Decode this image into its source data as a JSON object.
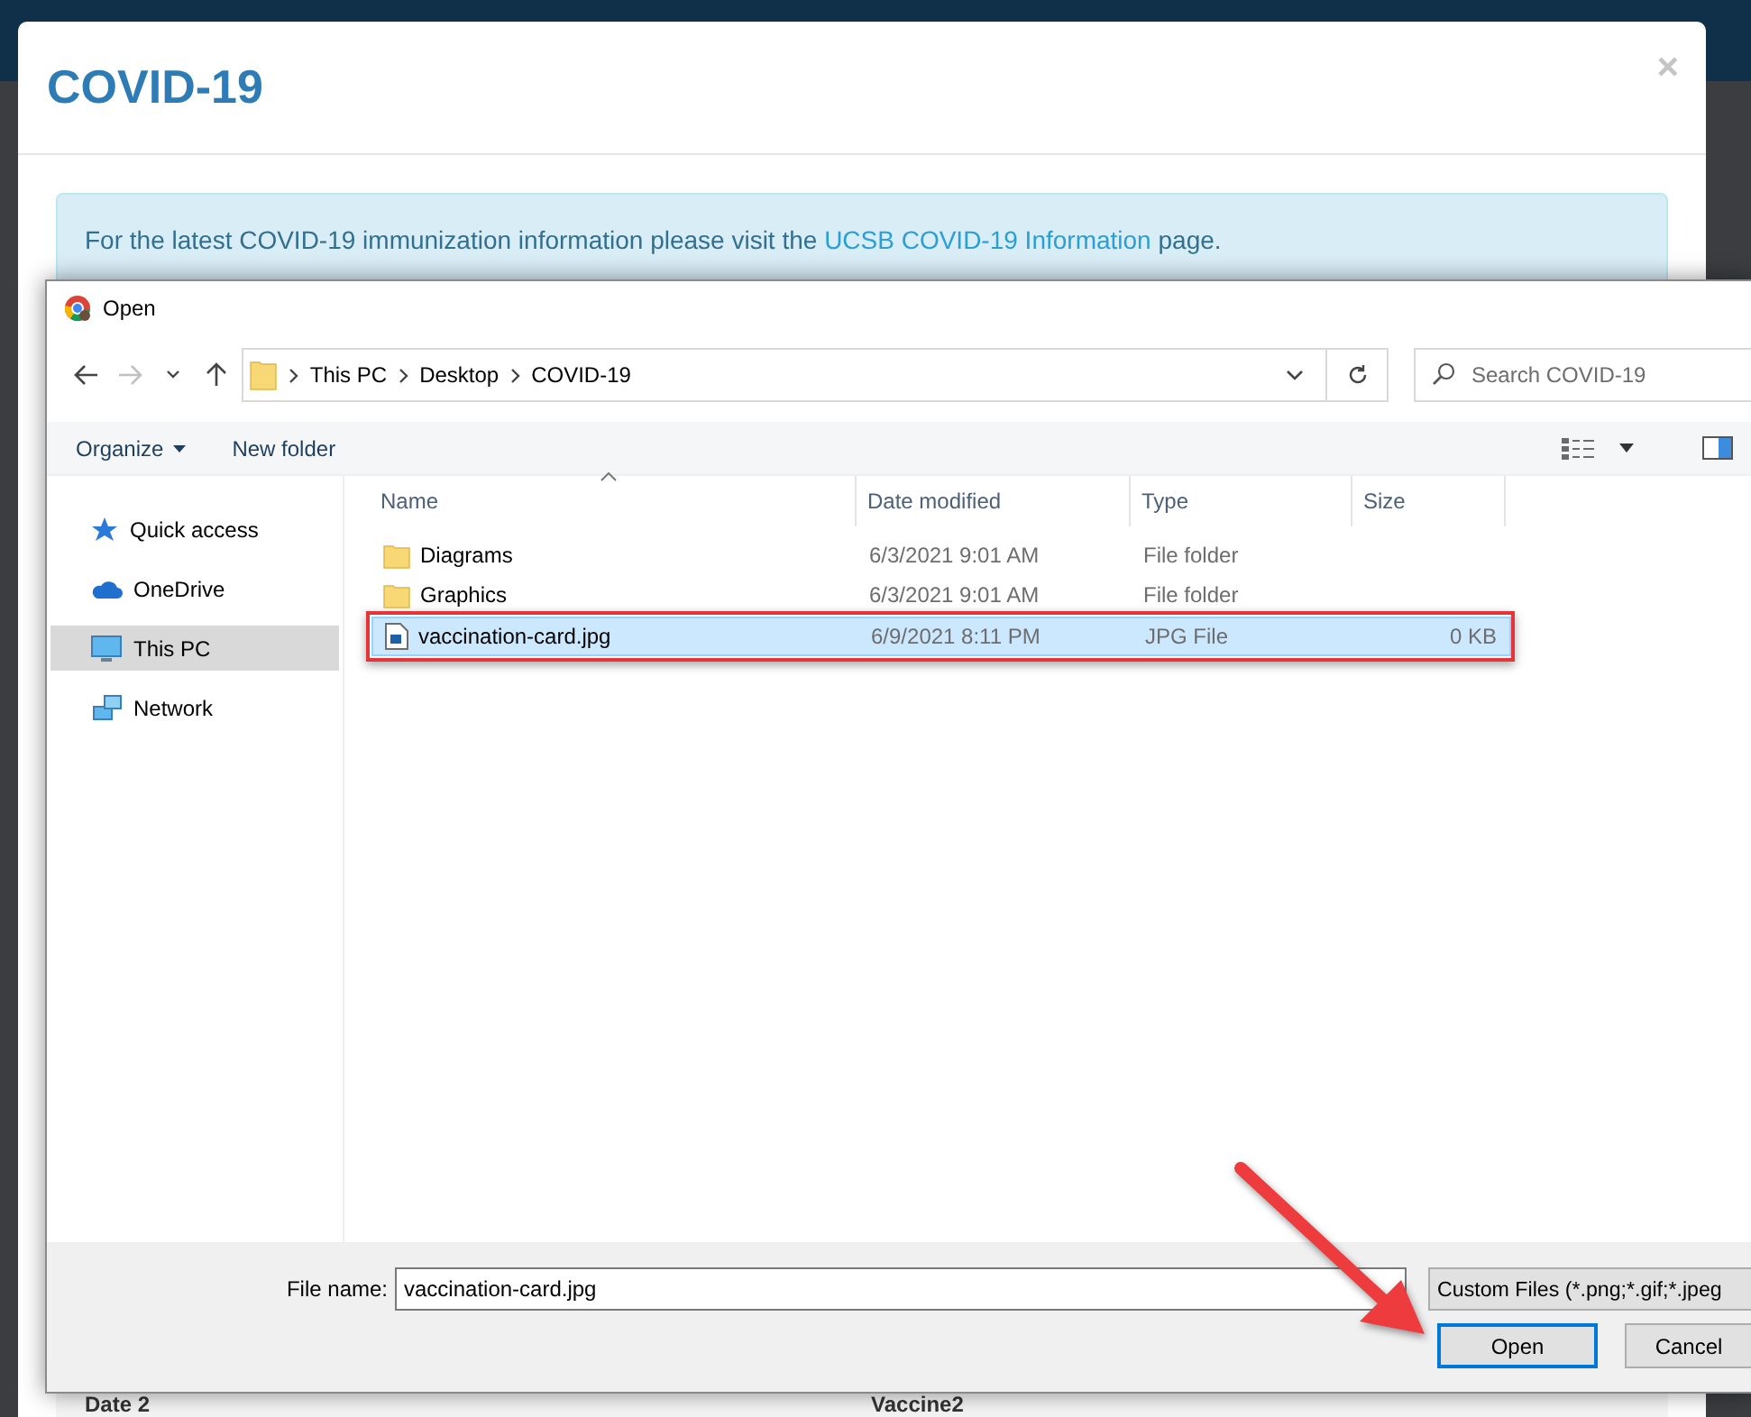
{
  "modal": {
    "title": "COVID-19",
    "close": "×",
    "alert": {
      "before": "For the latest COVID-19 immunization information please visit the ",
      "link": "UCSB COVID-19 Information",
      "after": " page."
    },
    "fields": [
      {
        "label": "Date 2"
      },
      {
        "label": "Vaccine2"
      }
    ]
  },
  "dialog": {
    "title": "Open",
    "nav": [
      {
        "kind": "back",
        "disabled": false
      },
      {
        "kind": "forward",
        "disabled": true
      },
      {
        "kind": "recent",
        "disabled": false
      },
      {
        "kind": "up",
        "disabled": false
      }
    ],
    "path": [
      "This PC",
      "Desktop",
      "COVID-19"
    ],
    "search": {
      "placeholder": "Search COVID-19"
    },
    "toolbar": [
      {
        "label": "Organize",
        "menu": true
      },
      {
        "label": "New folder",
        "menu": false
      }
    ],
    "sidebar": [
      {
        "label": "Quick access",
        "kind": "star",
        "selected": false
      },
      {
        "label": "OneDrive",
        "kind": "cloud",
        "selected": false
      },
      {
        "label": "This PC",
        "kind": "computer",
        "selected": true
      },
      {
        "label": "Network",
        "kind": "network",
        "selected": false
      }
    ],
    "columns": [
      {
        "label": "Name",
        "sorted": true
      },
      {
        "label": "Date modified",
        "sorted": false
      },
      {
        "label": "Type",
        "sorted": false
      },
      {
        "label": "Size",
        "sorted": false
      }
    ],
    "files": [
      {
        "name": "Diagrams",
        "date": "6/3/2021 9:01 AM",
        "type": "File folder",
        "kind": "folder",
        "selected": false,
        "highlighted": false
      },
      {
        "name": "Graphics",
        "date": "6/3/2021 9:01 AM",
        "type": "File folder",
        "kind": "folder",
        "selected": false,
        "highlighted": false
      },
      {
        "name": "vaccination-card.jpg",
        "date": "6/9/2021 8:11 PM",
        "type": "JPG File",
        "size": "0 KB",
        "kind": "image",
        "selected": true,
        "highlighted": true
      }
    ],
    "file_name": {
      "label": "File name:",
      "value": "vaccination-card.jpg"
    },
    "filter": "Custom Files (*.png;*.gif;*.jpeg",
    "buttons": [
      {
        "label": "Open",
        "default": true
      },
      {
        "label": "Cancel",
        "default": false
      }
    ]
  }
}
